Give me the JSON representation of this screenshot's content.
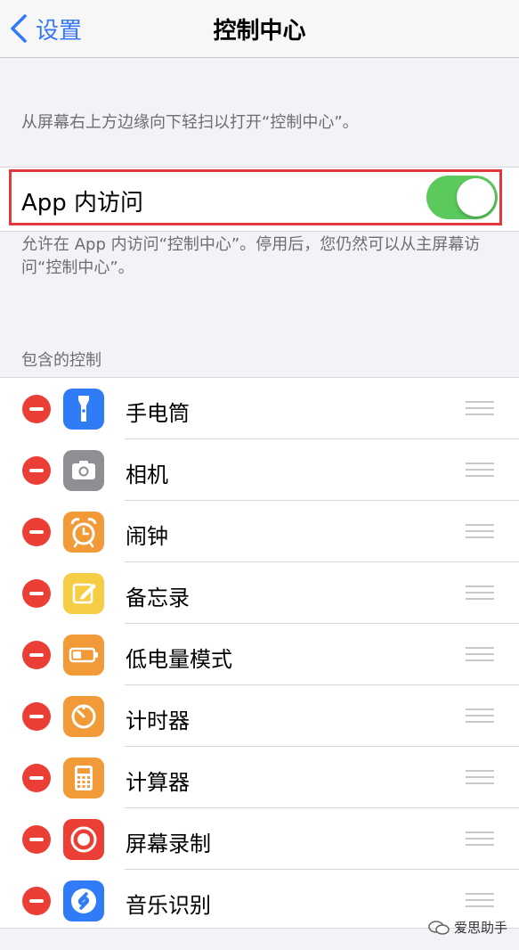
{
  "navbar": {
    "back_label": "设置",
    "title": "控制中心"
  },
  "swipe_description": "从屏幕右上方边缘向下轻扫以打开“控制中心”。",
  "access_within_apps": {
    "label": "App 内访问",
    "enabled": true,
    "description": "允许在 App 内访问“控制中心”。停用后，您仍然可以从主屏幕访问“控制中心”。"
  },
  "included_controls": {
    "header": "包含的控制",
    "items": [
      {
        "label": "手电筒",
        "icon": "flashlight-icon",
        "color": "#2f7cf6"
      },
      {
        "label": "相机",
        "icon": "camera-icon",
        "color": "#8e8e93"
      },
      {
        "label": "闹钟",
        "icon": "alarm-clock-icon",
        "color": "#f19a37"
      },
      {
        "label": "备忘录",
        "icon": "notes-icon",
        "color": "#f7cd45"
      },
      {
        "label": "低电量模式",
        "icon": "battery-icon",
        "color": "#f19a37"
      },
      {
        "label": "计时器",
        "icon": "timer-icon",
        "color": "#f19a37"
      },
      {
        "label": "计算器",
        "icon": "calculator-icon",
        "color": "#f19a37"
      },
      {
        "label": "屏幕录制",
        "icon": "screen-recording-icon",
        "color": "#eb3f35"
      },
      {
        "label": "音乐识别",
        "icon": "shazam-icon",
        "color": "#2f7cf6"
      }
    ]
  },
  "watermark": "爱思助手",
  "colors": {
    "accent": "#3478f6",
    "toggle_on": "#5cc95d",
    "delete": "#eb3f35",
    "highlight_box": "#e0393e"
  }
}
